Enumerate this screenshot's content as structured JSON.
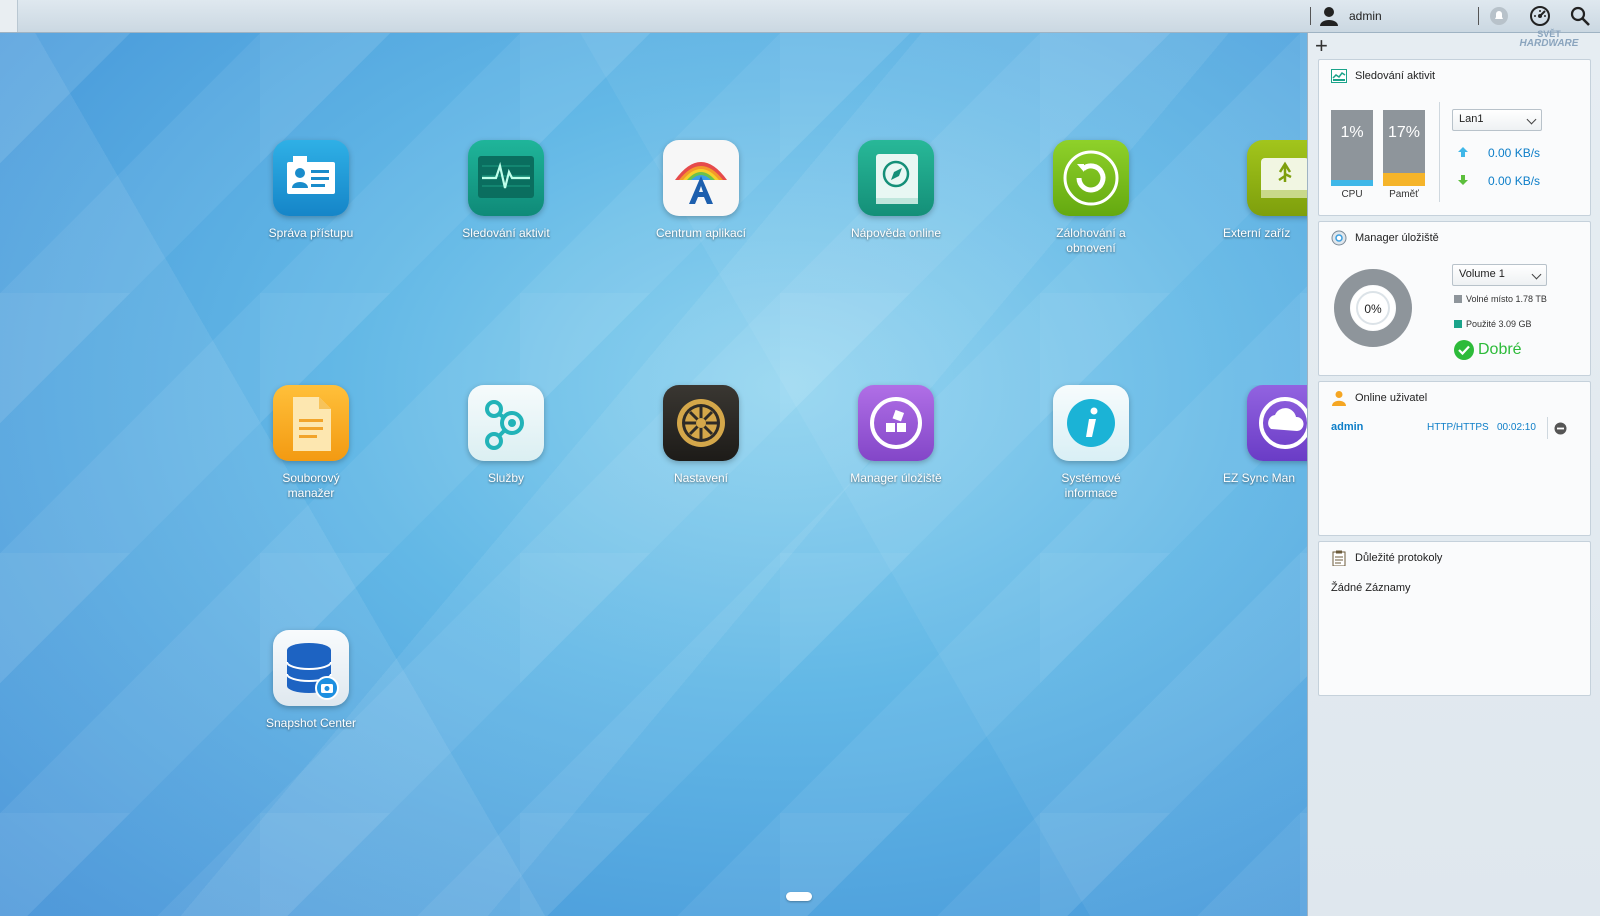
{
  "topbar": {
    "username": "admin",
    "icons": [
      "user-icon",
      "notification-icon",
      "dashboard-icon",
      "search-icon"
    ]
  },
  "watermark": {
    "line1": "SVĚT",
    "line2": "HARDWARE"
  },
  "apps": [
    {
      "label": "Správa přístupu",
      "icon": "access-card-icon",
      "color": "#1f9ad6"
    },
    {
      "label": "Sledování aktivit",
      "icon": "activity-monitor-icon",
      "color": "#129a86"
    },
    {
      "label": "Centrum aplikací",
      "icon": "app-center-icon",
      "color": "#f4f4f4"
    },
    {
      "label": "Nápověda online",
      "icon": "help-book-icon",
      "color": "#22a78e"
    },
    {
      "label": "Zálohování a obnovení",
      "icon": "backup-restore-icon",
      "color": "#7cbf1b"
    },
    {
      "label": "Externí zaříz",
      "icon": "external-device-icon",
      "color": "#8fb10f"
    },
    {
      "label": "Souborový manažer",
      "icon": "file-manager-icon",
      "color": "#f5a623"
    },
    {
      "label": "Služby",
      "icon": "services-icon",
      "color": "#e9f6f7"
    },
    {
      "label": "Nastavení",
      "icon": "settings-gear-icon",
      "color": "#2e2b27"
    },
    {
      "label": "Manager úložiště",
      "icon": "storage-manager-icon",
      "color": "#9b5bd6"
    },
    {
      "label": "Systémové informace",
      "icon": "system-info-icon",
      "color": "#e8f6fa"
    },
    {
      "label": "EZ Sync Man",
      "icon": "ez-sync-icon",
      "color": "#7f4fd2"
    },
    {
      "label": "Snapshot Center",
      "icon": "snapshot-database-icon",
      "color": "#eef3f7"
    }
  ],
  "panel": {
    "activity": {
      "title": "Sledování aktivit",
      "cpu_label": "CPU",
      "cpu_value": "1%",
      "cpu_fraction": 0.01,
      "mem_label": "Paměť",
      "mem_value": "17%",
      "mem_fraction": 0.17,
      "interface": "Lan1",
      "upload": "0.00 KB/s",
      "download": "0.00 KB/s"
    },
    "storage": {
      "title": "Manager úložiště",
      "volume": "Volume 1",
      "used_pct": "0%",
      "free_text": "Volné místo 1.78 TB",
      "used_text": "Použité 3.09 GB",
      "status": "Dobré"
    },
    "users": {
      "title": "Online uživatel",
      "rows": [
        {
          "name": "admin",
          "protocol": "HTTP/HTTPS",
          "time": "00:02:10"
        }
      ]
    },
    "logs": {
      "title": "Důležité protokoly",
      "empty": "Žádné Záznamy"
    }
  },
  "colors": {
    "accent_blue": "#0d7ec8",
    "mem_fill": "#f5b42a",
    "cpu_fill": "#3fb7e8",
    "good_green": "#2dbb3a",
    "used_teal": "#1aa38a"
  }
}
